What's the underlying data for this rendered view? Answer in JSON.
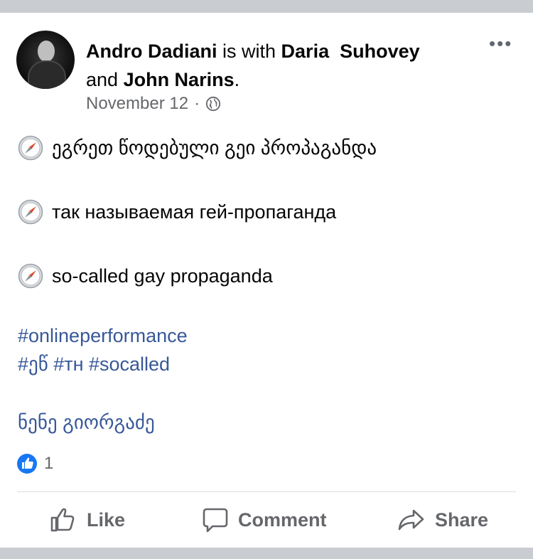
{
  "post": {
    "author": "Andro Dadiani",
    "with_text": " is with ",
    "tagged_1": "Daria  Suhovey",
    "and_text": "and ",
    "tagged_2": "John Narins",
    "period": ".",
    "date": "November 12",
    "separator": "·",
    "more_menu": "•••",
    "lines": [
      "ეგრეთ წოდებული გეი პროპაგანდა",
      "так называемая гей-пропаганда",
      "so-called gay propaganda"
    ],
    "hashtags": {
      "line1": "#onlineperformance",
      "line2": "#ეწ #тн #socalled"
    },
    "mention": "ნენე გიორგაძე",
    "reaction_count": "1"
  },
  "actions": {
    "like": "Like",
    "comment": "Comment",
    "share": "Share"
  },
  "colors": {
    "link": "#385898",
    "text": "#050505",
    "secondary": "#65676b",
    "like_blue": "#1877f2"
  },
  "icons": [
    "avatar",
    "globe-icon",
    "more-icon",
    "compass-icon",
    "like-reaction-icon",
    "like-icon",
    "comment-icon",
    "share-icon"
  ]
}
